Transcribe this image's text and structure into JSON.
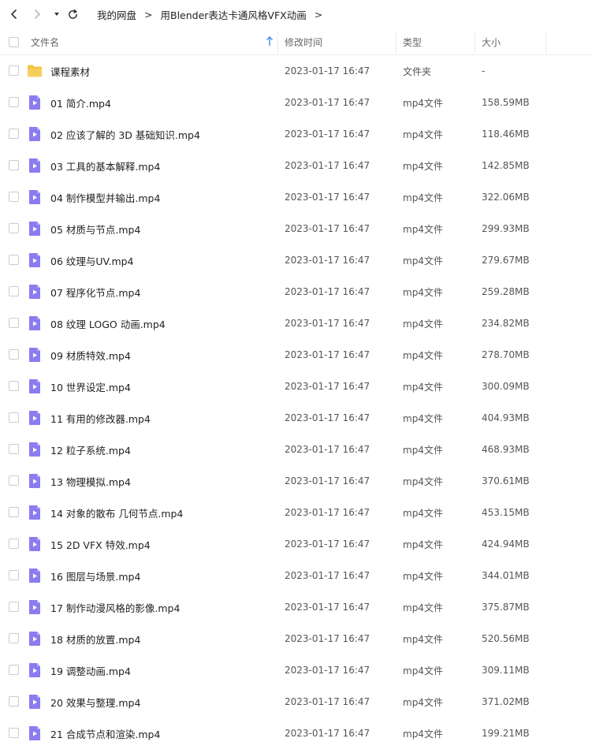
{
  "toolbar": {
    "back_icon": "chevron-left-icon",
    "forward_icon": "chevron-right-icon",
    "history_icon": "caret-down-icon",
    "refresh_icon": "refresh-icon"
  },
  "breadcrumb": {
    "items": [
      "我的网盘",
      "用Blender表达卡通风格VFX动画"
    ],
    "separator": ">"
  },
  "columns": {
    "name": "文件名",
    "sort_icon": "sort-up-arrow-icon",
    "modified": "修改时间",
    "type": "类型",
    "size": "大小"
  },
  "colors": {
    "folder": "#f5c242",
    "video_icon": "#8b7cf0",
    "sort_arrow": "#3b8cf5"
  },
  "files": [
    {
      "name": "课程素材",
      "modified": "2023-01-17 16:47",
      "type": "文件夹",
      "size": "-",
      "icon": "folder-icon"
    },
    {
      "name": "01 简介.mp4",
      "modified": "2023-01-17 16:47",
      "type": "mp4文件",
      "size": "158.59MB",
      "icon": "video-file-icon"
    },
    {
      "name": "02 应该了解的 3D 基础知识.mp4",
      "modified": "2023-01-17 16:47",
      "type": "mp4文件",
      "size": "118.46MB",
      "icon": "video-file-icon"
    },
    {
      "name": "03 工具的基本解释.mp4",
      "modified": "2023-01-17 16:47",
      "type": "mp4文件",
      "size": "142.85MB",
      "icon": "video-file-icon"
    },
    {
      "name": "04 制作模型并输出.mp4",
      "modified": "2023-01-17 16:47",
      "type": "mp4文件",
      "size": "322.06MB",
      "icon": "video-file-icon"
    },
    {
      "name": "05 材质与节点.mp4",
      "modified": "2023-01-17 16:47",
      "type": "mp4文件",
      "size": "299.93MB",
      "icon": "video-file-icon"
    },
    {
      "name": "06 纹理与UV.mp4",
      "modified": "2023-01-17 16:47",
      "type": "mp4文件",
      "size": "279.67MB",
      "icon": "video-file-icon"
    },
    {
      "name": "07 程序化节点.mp4",
      "modified": "2023-01-17 16:47",
      "type": "mp4文件",
      "size": "259.28MB",
      "icon": "video-file-icon"
    },
    {
      "name": "08 纹理 LOGO 动画.mp4",
      "modified": "2023-01-17 16:47",
      "type": "mp4文件",
      "size": "234.82MB",
      "icon": "video-file-icon"
    },
    {
      "name": "09 材质特效.mp4",
      "modified": "2023-01-17 16:47",
      "type": "mp4文件",
      "size": "278.70MB",
      "icon": "video-file-icon"
    },
    {
      "name": "10 世界设定.mp4",
      "modified": "2023-01-17 16:47",
      "type": "mp4文件",
      "size": "300.09MB",
      "icon": "video-file-icon"
    },
    {
      "name": "11 有用的修改器.mp4",
      "modified": "2023-01-17 16:47",
      "type": "mp4文件",
      "size": "404.93MB",
      "icon": "video-file-icon"
    },
    {
      "name": "12 粒子系统.mp4",
      "modified": "2023-01-17 16:47",
      "type": "mp4文件",
      "size": "468.93MB",
      "icon": "video-file-icon"
    },
    {
      "name": "13 物理模拟.mp4",
      "modified": "2023-01-17 16:47",
      "type": "mp4文件",
      "size": "370.61MB",
      "icon": "video-file-icon"
    },
    {
      "name": "14 对象的散布 几何节点.mp4",
      "modified": "2023-01-17 16:47",
      "type": "mp4文件",
      "size": "453.15MB",
      "icon": "video-file-icon"
    },
    {
      "name": "15 2D VFX 特效.mp4",
      "modified": "2023-01-17 16:47",
      "type": "mp4文件",
      "size": "424.94MB",
      "icon": "video-file-icon"
    },
    {
      "name": "16 图层与场景.mp4",
      "modified": "2023-01-17 16:47",
      "type": "mp4文件",
      "size": "344.01MB",
      "icon": "video-file-icon"
    },
    {
      "name": "17 制作动漫风格的影像.mp4",
      "modified": "2023-01-17 16:47",
      "type": "mp4文件",
      "size": "375.87MB",
      "icon": "video-file-icon"
    },
    {
      "name": "18 材质的放置.mp4",
      "modified": "2023-01-17 16:47",
      "type": "mp4文件",
      "size": "520.56MB",
      "icon": "video-file-icon"
    },
    {
      "name": "19 调整动画.mp4",
      "modified": "2023-01-17 16:47",
      "type": "mp4文件",
      "size": "309.11MB",
      "icon": "video-file-icon"
    },
    {
      "name": "20 效果与整理.mp4",
      "modified": "2023-01-17 16:47",
      "type": "mp4文件",
      "size": "371.02MB",
      "icon": "video-file-icon"
    },
    {
      "name": "21 合成节点和渲染.mp4",
      "modified": "2023-01-17 16:47",
      "type": "mp4文件",
      "size": "199.21MB",
      "icon": "video-file-icon"
    }
  ]
}
